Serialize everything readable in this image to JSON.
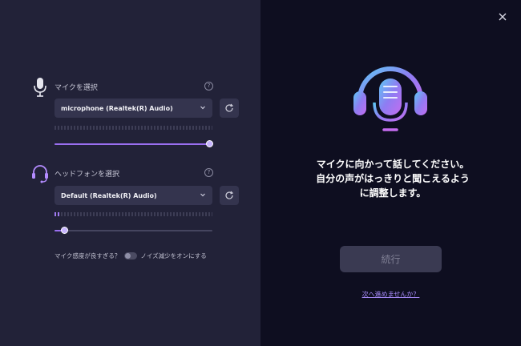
{
  "microphone": {
    "label": "マイクを選択",
    "help": "?",
    "device": "microphone (Realtek(R) Audio)",
    "meter_level": 0,
    "volume": 0.98
  },
  "headphones": {
    "label": "ヘッドフォンを選択",
    "help": "?",
    "device": "Default (Realtek(R) Audio)",
    "meter_level": 0.04,
    "volume": 0.06
  },
  "noise": {
    "question": "マイク感度が良すぎる？",
    "toggle_label": "ノイズ減少をオンにする",
    "enabled": false
  },
  "main": {
    "message_lines": [
      "マイクに向かって話してください。",
      "自分の声がはっきりと聞こえるよう",
      "に調整します。"
    ],
    "continue_label": "続行",
    "skip_link": "次へ進めませんか？"
  },
  "colors": {
    "accent": "#9a6ff0",
    "link": "#a78bfa",
    "panel": "#222238",
    "background": "#0e0e20"
  }
}
